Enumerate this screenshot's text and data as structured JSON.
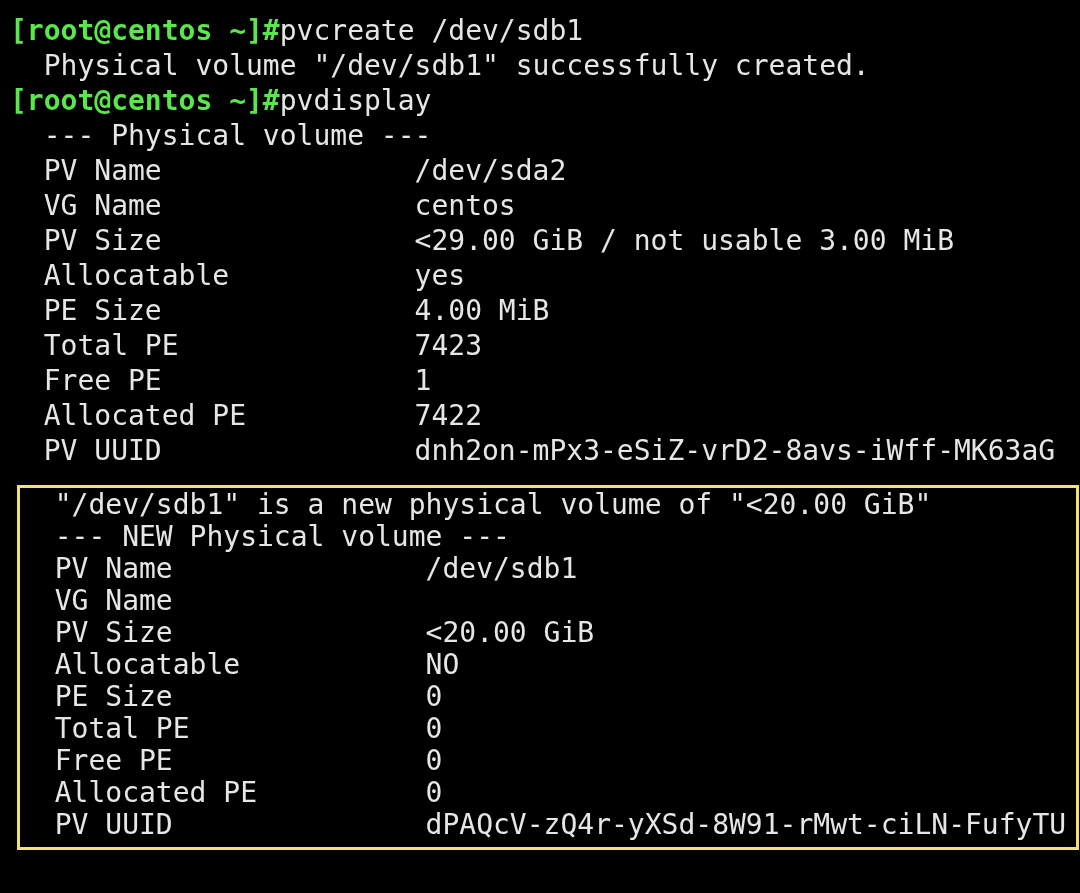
{
  "lines": [
    {
      "kind": "prompt",
      "prompt": "[root@centos ~]#",
      "command": "pvcreate /dev/sdb1"
    },
    {
      "kind": "output",
      "text": "Physical volume \"/dev/sdb1\" successfully created."
    },
    {
      "kind": "prompt",
      "prompt": "[root@centos ~]#",
      "command": "pvdisplay"
    }
  ],
  "sections": [
    {
      "highlighted": false,
      "header_lines": [
        "--- Physical volume ---"
      ],
      "fields": [
        {
          "label": "PV Name",
          "value": "/dev/sda2"
        },
        {
          "label": "VG Name",
          "value": "centos"
        },
        {
          "label": "PV Size",
          "value": "<29.00 GiB / not usable 3.00 MiB"
        },
        {
          "label": "Allocatable",
          "value": "yes"
        },
        {
          "label": "PE Size",
          "value": "4.00 MiB"
        },
        {
          "label": "Total PE",
          "value": "7423"
        },
        {
          "label": "Free PE",
          "value": "1"
        },
        {
          "label": "Allocated PE",
          "value": "7422"
        },
        {
          "label": "PV UUID",
          "value": "dnh2on-mPx3-eSiZ-vrD2-8avs-iWff-MK63aG"
        }
      ]
    },
    {
      "highlighted": true,
      "header_lines": [
        "\"/dev/sdb1\" is a new physical volume of \"<20.00 GiB\"",
        "--- NEW Physical volume ---"
      ],
      "fields": [
        {
          "label": "PV Name",
          "value": "/dev/sdb1"
        },
        {
          "label": "VG Name"
        },
        {
          "label": "PV Size",
          "value": "<20.00 GiB"
        },
        {
          "label": "Allocatable",
          "value": "NO"
        },
        {
          "label": "PE Size",
          "value": "0"
        },
        {
          "label": "Total PE",
          "value": "0"
        },
        {
          "label": "Free PE",
          "value": "0"
        },
        {
          "label": "Allocated PE",
          "value": "0"
        },
        {
          "label": "PV UUID",
          "value": "dPAQcV-zQ4r-yXSd-8W91-rMwt-ciLN-FufyTU"
        }
      ]
    }
  ]
}
